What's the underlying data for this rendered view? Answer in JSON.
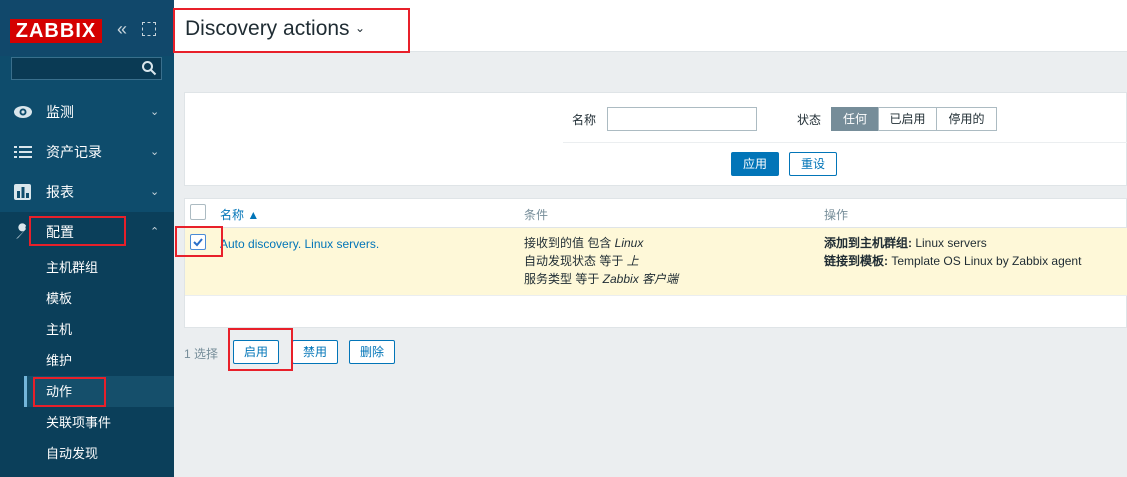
{
  "sidebar": {
    "logo": "ZABBIX",
    "search_placeholder": "",
    "nav": [
      {
        "label": "监测",
        "icon": "eye-icon"
      },
      {
        "label": "资产记录",
        "icon": "list-icon"
      },
      {
        "label": "报表",
        "icon": "bar-chart-icon"
      },
      {
        "label": "配置",
        "icon": "wrench-icon"
      }
    ],
    "submenu": [
      "主机群组",
      "模板",
      "主机",
      "维护",
      "动作",
      "关联项事件",
      "自动发现"
    ]
  },
  "header": {
    "title": "Discovery actions"
  },
  "filter": {
    "name_label": "名称",
    "name_value": "",
    "status_label": "状态",
    "status_options": [
      "任何",
      "已启用",
      "停用的"
    ],
    "status_selected": "任何",
    "apply": "应用",
    "reset": "重设"
  },
  "table": {
    "columns": {
      "name": "名称 ▲",
      "conditions": "条件",
      "operations": "操作"
    },
    "rows": [
      {
        "name": "Auto discovery. Linux servers.",
        "checked": true,
        "conditions": [
          {
            "text": "接收到的值 包含 ",
            "value": "Linux"
          },
          {
            "text": "自动发现状态 等于 ",
            "value": "上"
          },
          {
            "text": "服务类型 等于 ",
            "value": "Zabbix 客户端"
          }
        ],
        "operations": [
          {
            "label": "添加到主机群组:",
            "value": " Linux servers"
          },
          {
            "label": "链接到模板:",
            "value": " Template OS Linux by Zabbix agent"
          }
        ]
      }
    ]
  },
  "footer": {
    "selected_count": "1 选择",
    "enable": "启用",
    "disable": "禁用",
    "delete": "删除"
  },
  "colors": {
    "sidebar": "#0e4c6c",
    "accent": "#0275b8",
    "highlight_row": "#fef8d8",
    "annotation": "#e8202a"
  }
}
